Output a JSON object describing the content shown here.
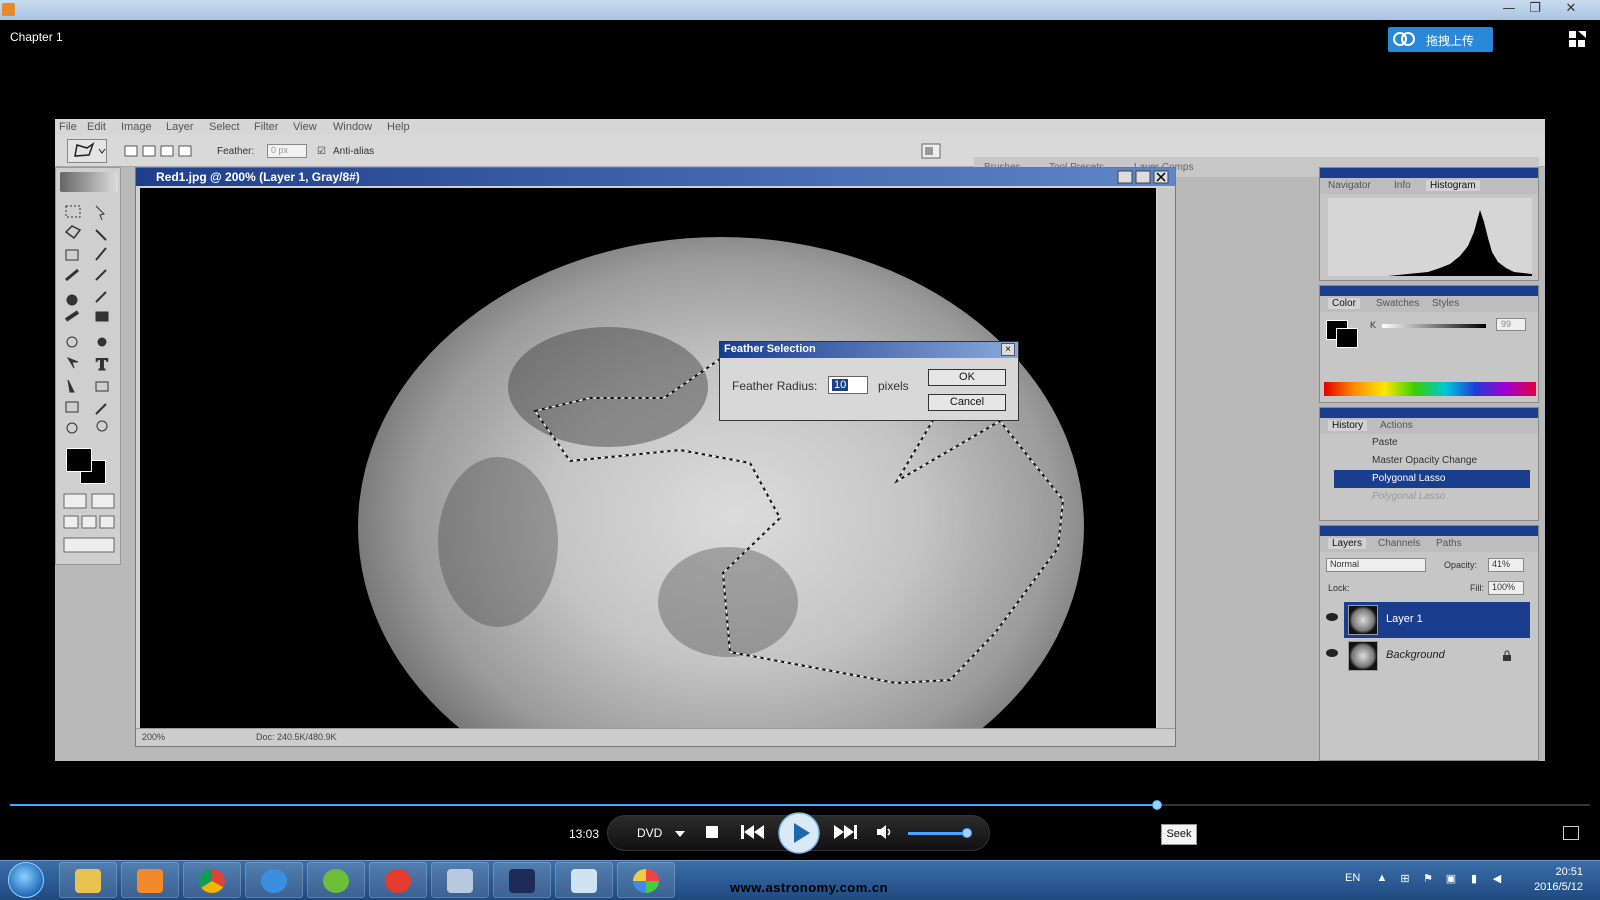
{
  "window": {
    "title": "Chapter 1",
    "min": "—",
    "max": "❐",
    "close": "✕",
    "upload_label": "拖拽上传"
  },
  "photoshop": {
    "menu": [
      "File",
      "Edit",
      "Image",
      "Layer",
      "Select",
      "Filter",
      "View",
      "Window",
      "Help"
    ],
    "options": {
      "feather_label": "Feather:",
      "feather_value": "0 px",
      "anti_alias_label": "Anti-alias"
    },
    "palette_well": [
      "Brushes",
      "Tool Presets",
      "Layer Comps"
    ],
    "document": {
      "title": "Red1.jpg @ 200% (Layer 1, Gray/8#)",
      "zoom": "200%",
      "doc_size": "Doc: 240.5K/480.9K"
    },
    "dialog": {
      "title": "Feather Selection",
      "radius_label": "Feather Radius:",
      "radius_value": "10",
      "unit": "pixels",
      "ok": "OK",
      "cancel": "Cancel"
    },
    "panels": {
      "navigator_tabs": [
        "Navigator",
        "Info",
        "Histogram"
      ],
      "color_tabs": [
        "Color",
        "Swatches",
        "Styles"
      ],
      "color_channel": "K",
      "color_value": "99",
      "history_tabs": [
        "History",
        "Actions"
      ],
      "history_items": [
        "Paste",
        "Master Opacity Change",
        "Polygonal Lasso",
        "Polygonal Lasso"
      ],
      "layers_tabs": [
        "Layers",
        "Channels",
        "Paths"
      ],
      "blend_mode": "Normal",
      "opacity_label": "Opacity:",
      "opacity_value": "41%",
      "lock_label": "Lock:",
      "fill_label": "Fill:",
      "fill_value": "100%",
      "layers": [
        "Layer 1",
        "Background"
      ]
    }
  },
  "player": {
    "time": "13:03",
    "source": "DVD",
    "seek_label": "Seek",
    "progress": 0.726,
    "volume": 0.95
  },
  "taskbar": {
    "url": "www.astronomy.com.cn",
    "lang": "EN",
    "time": "20:51",
    "date": "2016/5/12"
  }
}
